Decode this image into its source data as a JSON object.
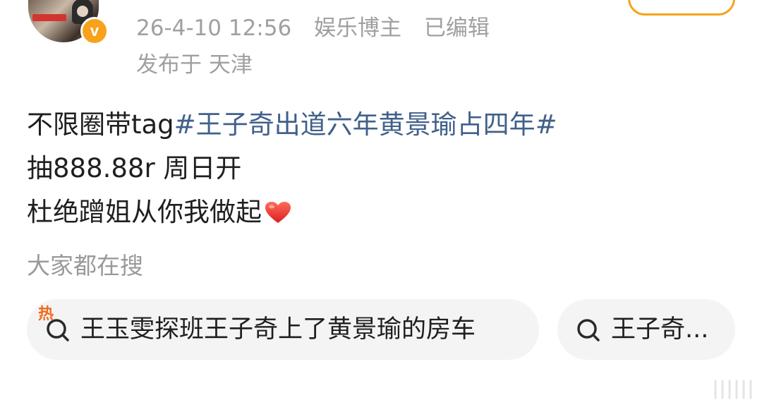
{
  "post": {
    "meta": {
      "datetime": "26-4-10 12:56",
      "category": "娱乐博主",
      "edited": "已编辑"
    },
    "location": "发布于 天津",
    "body": {
      "line1_prefix": "不限圈带tag",
      "line1_hashtag": "#王子奇出道六年黄景瑜占四年#",
      "line2": "抽888.88r 周日开",
      "line3": "杜绝蹭姐从你我做起"
    },
    "icons": {
      "verified": "verified-v-icon",
      "heart": "heart-icon"
    }
  },
  "search": {
    "title": "大家都在搜",
    "items": [
      {
        "badge": "热",
        "text": "王玉雯探班王子奇上了黄景瑜的房车",
        "icon": "search-icon"
      },
      {
        "text": "王子奇...",
        "icon": "search-icon"
      }
    ]
  },
  "colors": {
    "hashtag": "#41608a",
    "meta": "#a0a0a0",
    "accent": "#f7a21a",
    "hot": "#f06a1f",
    "heart": "#e8302e",
    "pill_bg": "#f4f4f4"
  }
}
